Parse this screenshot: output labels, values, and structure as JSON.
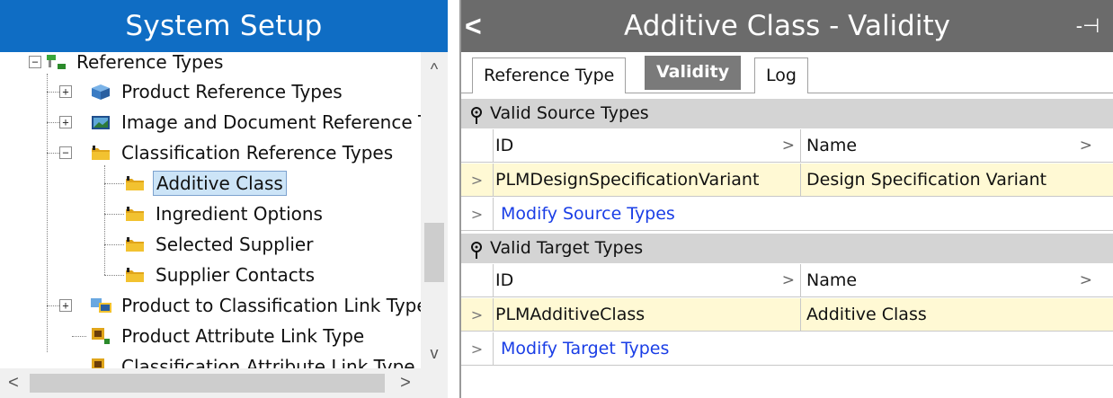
{
  "left_panel": {
    "title": "System Setup",
    "tree": [
      {
        "label": "Reference Types",
        "icon": "reference-types-icon"
      },
      {
        "label": "Product Reference Types",
        "icon": "product-reference-icon"
      },
      {
        "label": "Image and Document Reference T",
        "icon": "image-reference-icon"
      },
      {
        "label": "Classification Reference Types",
        "icon": "folder-icon"
      },
      {
        "label": "Additive Class",
        "icon": "folder-icon",
        "selected": true
      },
      {
        "label": "Ingredient Options",
        "icon": "folder-icon"
      },
      {
        "label": "Selected Supplier",
        "icon": "folder-icon"
      },
      {
        "label": "Supplier Contacts",
        "icon": "folder-icon"
      },
      {
        "label": "Product to Classification Link Types",
        "icon": "link-types-icon"
      },
      {
        "label": "Product Attribute Link Type",
        "icon": "attribute-link-icon"
      },
      {
        "label": "Classification Attribute Link Type",
        "icon": "attribute-link-icon"
      }
    ],
    "expanders": {
      "expanded": "−",
      "collapsed": "+"
    },
    "scroll": {
      "up": "^",
      "down": "v",
      "left": "<",
      "right": ">"
    }
  },
  "right_panel": {
    "title": "Additive Class - Validity",
    "back": "<",
    "pin": "-⊣",
    "tabs": [
      {
        "label": "Reference Type",
        "active": false
      },
      {
        "label": "Validity",
        "active": true
      },
      {
        "label": "Log",
        "active": false
      }
    ],
    "sections": [
      {
        "header": "Valid Source Types",
        "columns": [
          "ID",
          "Name"
        ],
        "rows": [
          {
            "id": "PLMDesignSpecificationVariant",
            "name": "Design Specification Variant"
          }
        ],
        "action": "Modify Source Types"
      },
      {
        "header": "Valid Target Types",
        "columns": [
          "ID",
          "Name"
        ],
        "rows": [
          {
            "id": "PLMAdditiveClass",
            "name": "Additive Class"
          }
        ],
        "action": "Modify Target Types"
      }
    ],
    "row_marker": ">",
    "col_marker": ">"
  }
}
